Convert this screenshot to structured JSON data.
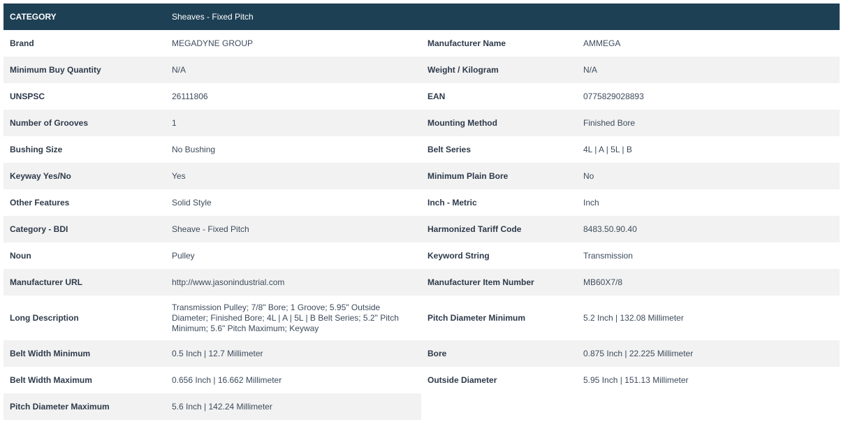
{
  "header": {
    "label": "CATEGORY",
    "value": "Sheaves - Fixed Pitch"
  },
  "left": [
    {
      "label": "Brand",
      "value": "MEGADYNE GROUP"
    },
    {
      "label": "Minimum Buy Quantity",
      "value": "N/A"
    },
    {
      "label": "UNSPSC",
      "value": "26111806"
    },
    {
      "label": "Number of Grooves",
      "value": "1"
    },
    {
      "label": "Bushing Size",
      "value": "No Bushing"
    },
    {
      "label": "Keyway Yes/No",
      "value": "Yes"
    },
    {
      "label": "Other Features",
      "value": "Solid Style"
    },
    {
      "label": "Category - BDI",
      "value": "Sheave - Fixed Pitch"
    },
    {
      "label": "Noun",
      "value": "Pulley"
    },
    {
      "label": "Manufacturer URL",
      "value": "http://www.jasonindustrial.com"
    },
    {
      "label": "Long Description",
      "value": "Transmission Pulley; 7/8\" Bore; 1 Groove; 5.95\" Outside Diameter; Finished Bore; 4L | A | 5L | B Belt Series; 5.2\" Pitch Minimum; 5.6\" Pitch Maximum; Keyway"
    },
    {
      "label": "Belt Width Minimum",
      "value": "0.5 Inch | 12.7 Millimeter"
    },
    {
      "label": "Belt Width Maximum",
      "value": "0.656 Inch | 16.662 Millimeter"
    },
    {
      "label": "Pitch Diameter Maximum",
      "value": "5.6 Inch | 142.24 Millimeter"
    }
  ],
  "right": [
    {
      "label": "Manufacturer Name",
      "value": "AMMEGA"
    },
    {
      "label": "Weight / Kilogram",
      "value": "N/A"
    },
    {
      "label": "EAN",
      "value": "0775829028893"
    },
    {
      "label": "Mounting Method",
      "value": "Finished Bore"
    },
    {
      "label": "Belt Series",
      "value": "4L | A | 5L | B"
    },
    {
      "label": "Minimum Plain Bore",
      "value": "No"
    },
    {
      "label": "Inch - Metric",
      "value": "Inch"
    },
    {
      "label": "Harmonized Tariff Code",
      "value": "8483.50.90.40"
    },
    {
      "label": "Keyword String",
      "value": "Transmission"
    },
    {
      "label": "Manufacturer Item Number",
      "value": "MB60X7/8"
    },
    {
      "label": "Pitch Diameter Minimum",
      "value": "5.2 Inch | 132.08 Millimeter"
    },
    {
      "label": "Bore",
      "value": "0.875 Inch | 22.225 Millimeter"
    },
    {
      "label": "Outside Diameter",
      "value": "5.95 Inch | 151.13 Millimeter"
    }
  ]
}
